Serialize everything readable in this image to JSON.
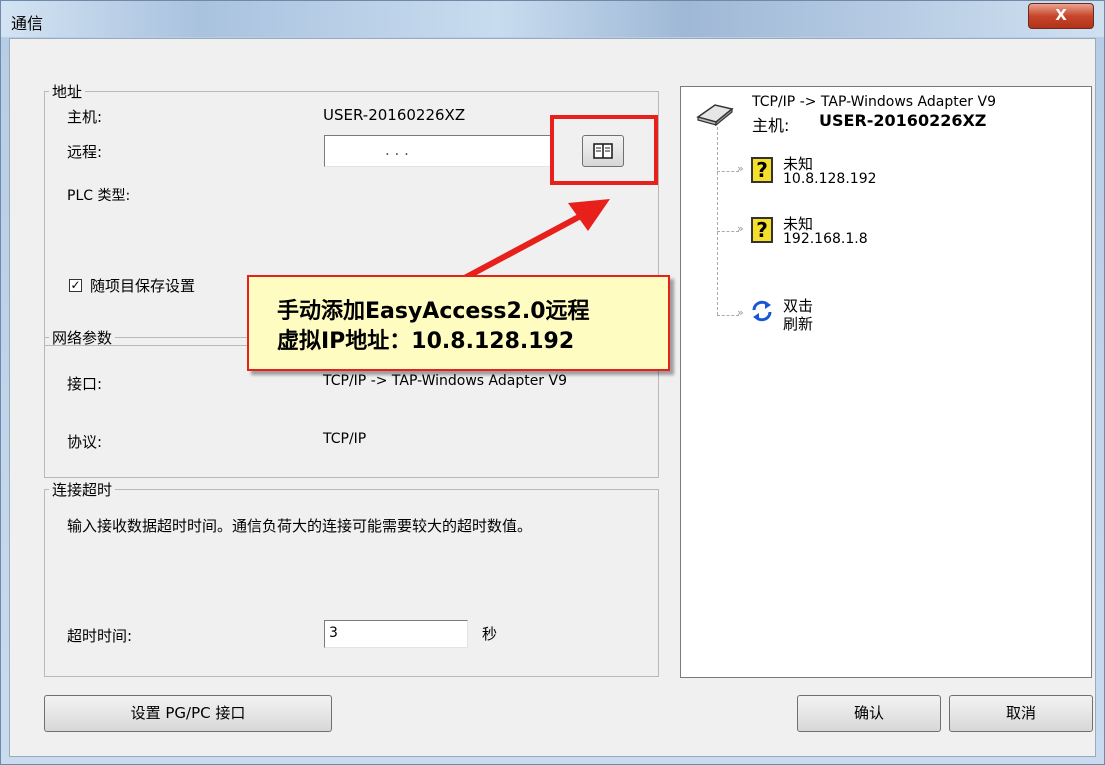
{
  "window": {
    "title": "通信",
    "close_label": "X"
  },
  "address": {
    "legend": "地址",
    "host_label": "主机:",
    "host_value": "USER-20160226XZ",
    "remote_label": "远程:",
    "remote_ip_placeholder": ".     .     .",
    "plc_type_label": "PLC 类型:",
    "save_with_project_label": "随项目保存设置",
    "save_with_project_checked": "✓"
  },
  "network": {
    "legend": "网络参数",
    "interface_label": "接口:",
    "interface_value": "TCP/IP -> TAP-Windows Adapter V9",
    "protocol_label": "协议:",
    "protocol_value": "TCP/IP"
  },
  "timeout": {
    "legend": "连接超时",
    "description": "输入接收数据超时时间。通信负荷大的连接可能需要较大的超时数值。",
    "time_label": "超时时间:",
    "time_value": "3",
    "unit": "秒"
  },
  "tree": {
    "root_line1": "TCP/IP -> TAP-Windows Adapter V9",
    "root_line2_label": "主机:",
    "root_line2_value": "USER-20160226XZ",
    "nodes": [
      {
        "name": "未知",
        "ip": "10.8.128.192"
      },
      {
        "name": "未知",
        "ip": "192.168.1.8"
      }
    ],
    "refresh_line1": "双击",
    "refresh_line2": "刷新"
  },
  "annotation": {
    "line1": "手动添加EasyAccess2.0远程",
    "line2": "虚拟IP地址：10.8.128.192"
  },
  "buttons": {
    "pgpc": "设置 PG/PC 接口",
    "ok": "确认",
    "cancel": "取消"
  },
  "colors": {
    "annotation_red": "#e8201c",
    "callout_fill": "#fffcc2",
    "refresh_blue": "#1a55d6"
  }
}
